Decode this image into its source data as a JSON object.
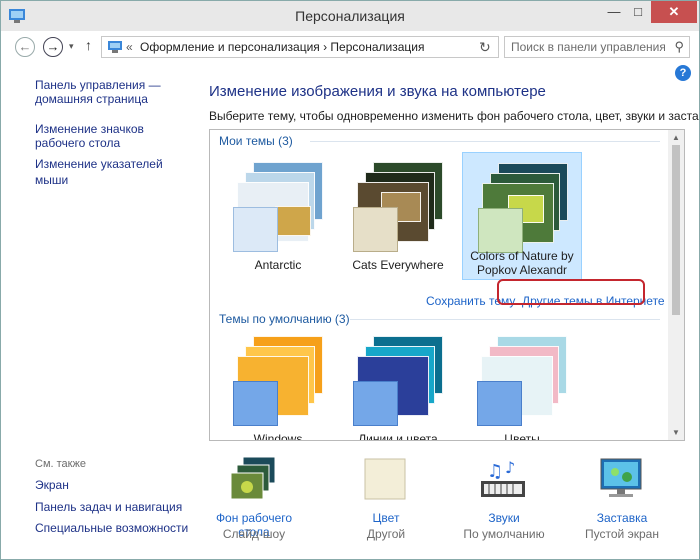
{
  "window": {
    "title": "Персонализация",
    "minimize": "—",
    "maximize": "□",
    "close": "✕"
  },
  "addressbar": {
    "recent": "«",
    "path": "Оформление и персонализация  ›  Персонализация",
    "search_placeholder": "Поиск в панели управления"
  },
  "leftpane": {
    "links": [
      {
        "label": "Панель управления —"
      },
      {
        "label": "домашняя страница"
      },
      {
        "label": "Изменение значков"
      },
      {
        "label": "рабочего стола"
      },
      {
        "label": "Изменение указателей мыши"
      }
    ],
    "see_also_title": "См. также",
    "see_also": [
      {
        "label": "Экран"
      },
      {
        "label": "Панель задач и навигация"
      },
      {
        "label": "Специальные возможности"
      }
    ]
  },
  "main": {
    "heading": "Изменение изображения и звука на компьютере",
    "description": "Выберите тему, чтобы одновременно изменить фон рабочего стола, цвет, звуки и заставку.",
    "help": "?",
    "my_themes_title": "Мои темы (3)",
    "my_themes": [
      {
        "label": "Antarctic",
        "colors": [
          "#dfe8ef",
          "#9fc3de",
          "#f5f7fa"
        ]
      },
      {
        "label": "Cats Everywhere",
        "colors": [
          "#2f3b25",
          "#7b6a45",
          "#c8ba96"
        ]
      },
      {
        "label": "Colors of Nature by",
        "label2": "Popkov Alexandr",
        "colors": [
          "#1b4a5a",
          "#2c6b3a",
          "#8fb65c"
        ]
      }
    ],
    "save_theme": "Сохранить тему",
    "more_themes": "Другие темы в Интернете",
    "default_themes_title": "Темы по умолчанию (3)",
    "default_themes": [
      {
        "label": "Windows",
        "colors": [
          "#f6a01a",
          "#ffc64a",
          "#f7b230"
        ]
      },
      {
        "label": "Линии и цвета",
        "colors": [
          "#0b6f8f",
          "#17a7c9",
          "#2b3f9a"
        ]
      },
      {
        "label": "Цветы",
        "colors": [
          "#e7f3f6",
          "#f2b9c6",
          "#a9d9e6"
        ]
      }
    ]
  },
  "bottom": [
    {
      "label": "Фон рабочего стола",
      "sub": "Слайд-шоу",
      "icon": "desktop-background-icon"
    },
    {
      "label": "Цвет",
      "sub": "Другой",
      "icon": "color-swatch-icon"
    },
    {
      "label": "Звуки",
      "sub": "По умолчанию",
      "icon": "sounds-icon"
    },
    {
      "label": "Заставка",
      "sub": "Пустой экран",
      "icon": "screensaver-icon"
    }
  ],
  "accent": "#1e3287"
}
